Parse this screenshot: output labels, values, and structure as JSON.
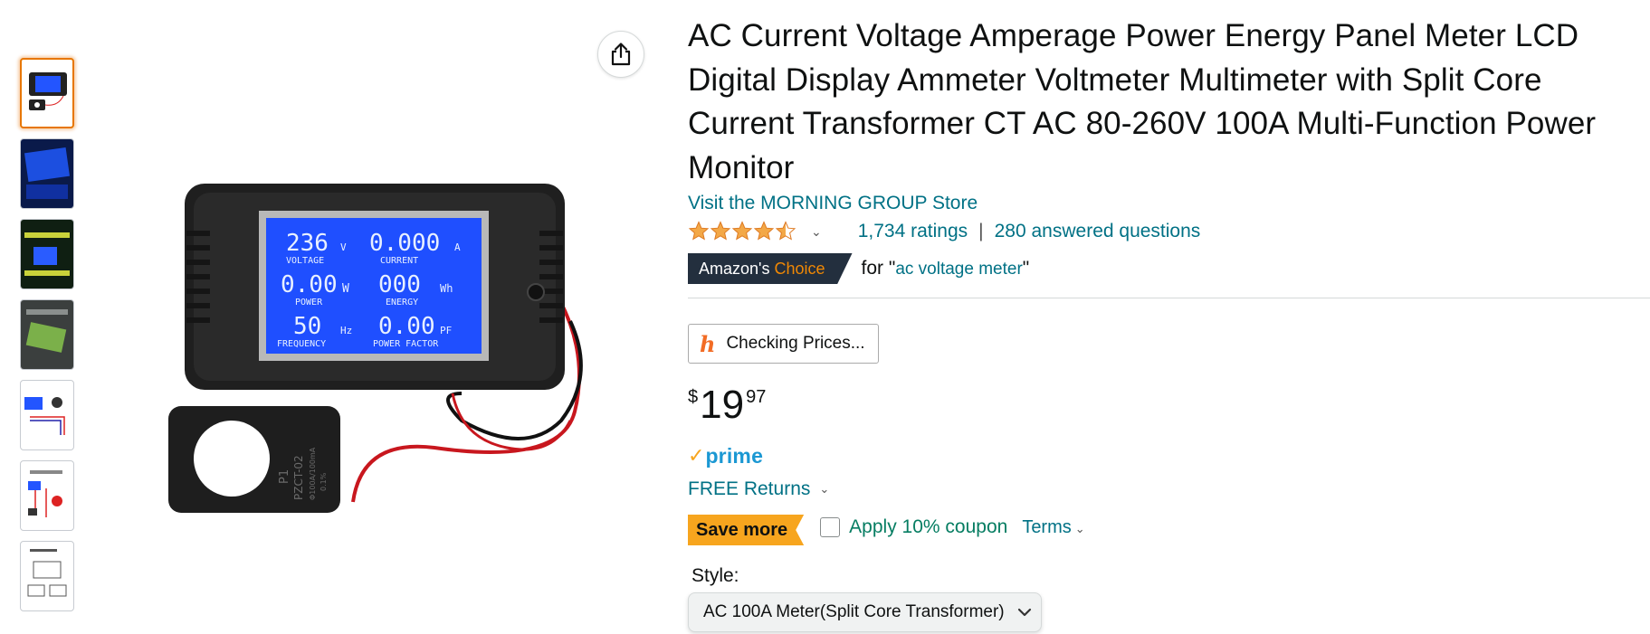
{
  "product": {
    "title": "AC Current Voltage Amperage Power Energy Panel Meter LCD Digital Display Ammeter Voltmeter Multimeter with Split Core Current Transformer CT AC 80-260V 100A Multi-Function Power Monitor",
    "store_link": "Visit the MORNING GROUP Store",
    "rating_stars": 4.5,
    "ratings_count": "1,734 ratings",
    "separator": "|",
    "answered_questions": "280 answered questions",
    "badge": {
      "prefix": "Amazon's",
      "highlight": "Choice"
    },
    "badge_for": "for \"",
    "badge_query": "ac voltage meter",
    "badge_close": "\""
  },
  "honey": {
    "label": "Checking Prices..."
  },
  "price": {
    "symbol": "$",
    "whole": "19",
    "fraction": "97"
  },
  "prime": {
    "label": "prime"
  },
  "returns": {
    "label": "FREE Returns"
  },
  "coupon": {
    "badge": "Save more",
    "label": "Apply 10% coupon",
    "terms": "Terms"
  },
  "style": {
    "label": "Style:",
    "selected": "AC 100A Meter(Split Core Transformer)"
  },
  "meter_display": {
    "voltage_value": "236",
    "voltage_unit": "V",
    "voltage_label": "VOLTAGE",
    "current_value": "0.000",
    "current_unit": "A",
    "current_label": "CURRENT",
    "power_value": "0.00",
    "power_unit": "W",
    "power_label": "POWER",
    "energy_value": "000",
    "energy_unit": "Wh",
    "energy_label": "ENERGY",
    "frequency_value": "50",
    "frequency_unit": "Hz",
    "frequency_label": "FREQUENCY",
    "pf_value": "0.00",
    "pf_unit": "PF",
    "pf_label": "POWER FACTOR"
  },
  "ct_label": {
    "line1": "P1",
    "line2": "PZCT-02",
    "line3": "Φ100A/100mA",
    "line4": "0.1%"
  },
  "colors": {
    "link": "#007185",
    "price_text": "#0f1111",
    "badge_dark": "#232f3e",
    "badge_orange": "#f08804",
    "save_more": "#f7a51e",
    "coupon_green": "#067d62",
    "prime_blue": "#1b98d3",
    "lcd_blue": "#1f4fff"
  },
  "icons": {
    "share": "share-icon",
    "star": "star-icon",
    "chevron": "chevron-down-icon",
    "honey": "honey-icon"
  }
}
